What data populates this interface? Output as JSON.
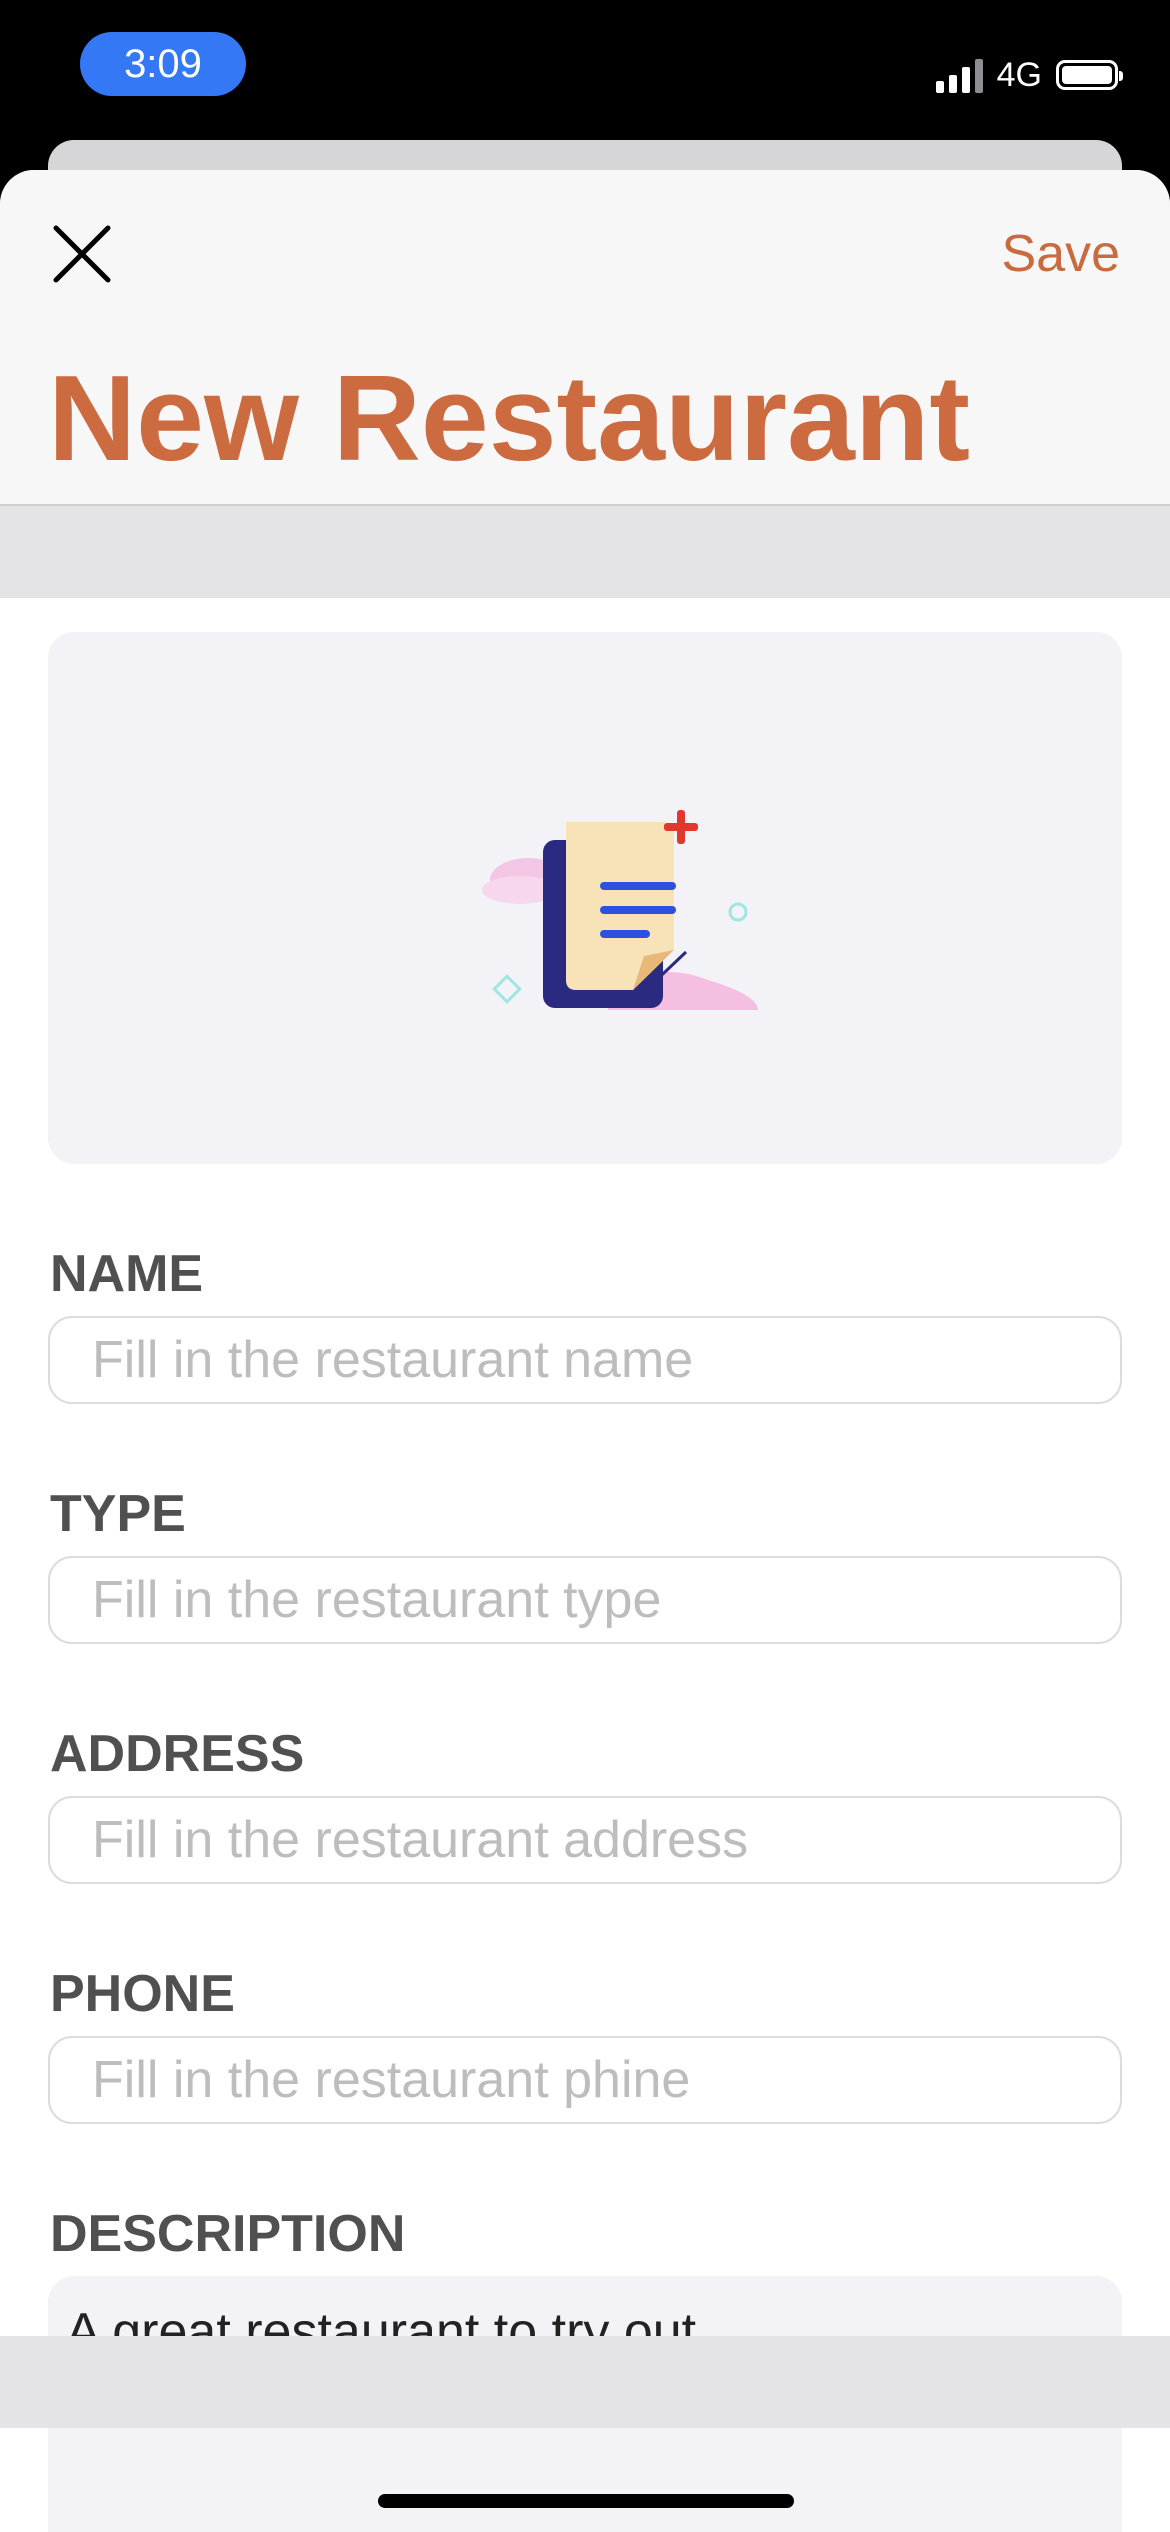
{
  "status_bar": {
    "time": "3:09",
    "network": "4G",
    "battery_level": 1.0
  },
  "header": {
    "save_label": "Save",
    "title": "New Restaurant",
    "accent_color": "#cc6a40"
  },
  "icons": {
    "close": "close-icon",
    "illustration": "menu-document-illustration"
  },
  "form": {
    "name": {
      "label": "NAME",
      "placeholder": "Fill in the restaurant name",
      "value": ""
    },
    "type": {
      "label": "TYPE",
      "placeholder": "Fill in the restaurant type",
      "value": ""
    },
    "address": {
      "label": "ADDRESS",
      "placeholder": "Fill in the restaurant address",
      "value": ""
    },
    "phone": {
      "label": "PHONE",
      "placeholder": "Fill in the restaurant phine",
      "value": ""
    },
    "description": {
      "label": "DESCRIPTION",
      "value": "A great restaurant to try out"
    }
  }
}
